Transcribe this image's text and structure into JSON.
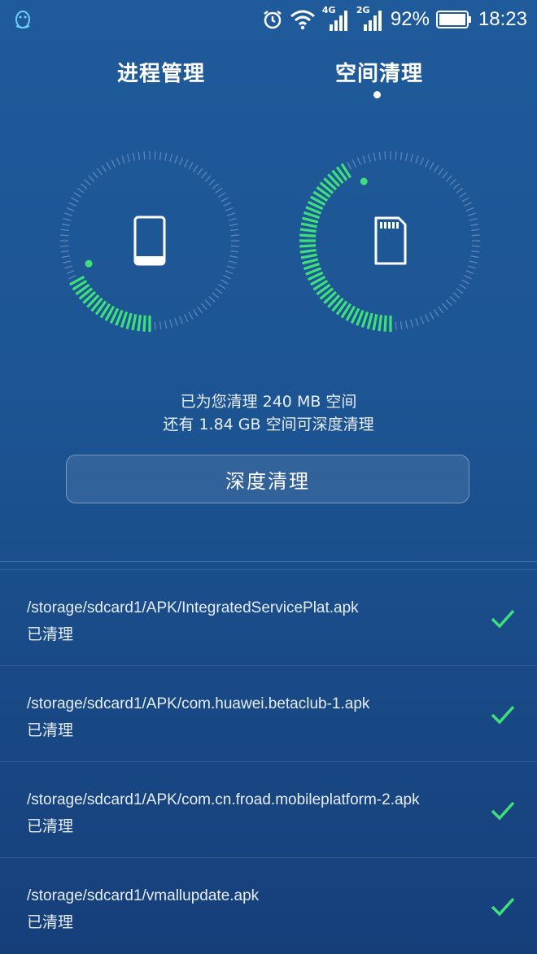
{
  "status_bar": {
    "app_icon": "qq-penguin-icon",
    "net1_label": "4G",
    "net2_label": "2G",
    "battery_percent": "92%",
    "time": "18:23"
  },
  "tabs": [
    {
      "label": "进程管理",
      "active": false
    },
    {
      "label": "空间清理",
      "active": true
    }
  ],
  "gauges": {
    "left": {
      "icon": "phone-icon",
      "progress": 0.18
    },
    "right": {
      "icon": "sdcard-icon",
      "progress": 0.42
    }
  },
  "summary": {
    "line1": "已为您清理 240 MB 空间",
    "line2": "还有 1.84 GB 空间可深度清理"
  },
  "deep_clean_button": "深度清理",
  "items": [
    {
      "path": "/storage/sdcard1/APK/IntegratedServicePlat.apk",
      "status": "已清理"
    },
    {
      "path": "/storage/sdcard1/APK/com.huawei.betaclub-1.apk",
      "status": "已清理"
    },
    {
      "path": "/storage/sdcard1/APK/com.cn.froad.mobileplatform-2.apk",
      "status": "已清理"
    },
    {
      "path": "/storage/sdcard1/vmallupdate.apk",
      "status": "已清理"
    }
  ],
  "colors": {
    "accent_green": "#3ee07a",
    "tick_idle": "#6f97c4"
  }
}
